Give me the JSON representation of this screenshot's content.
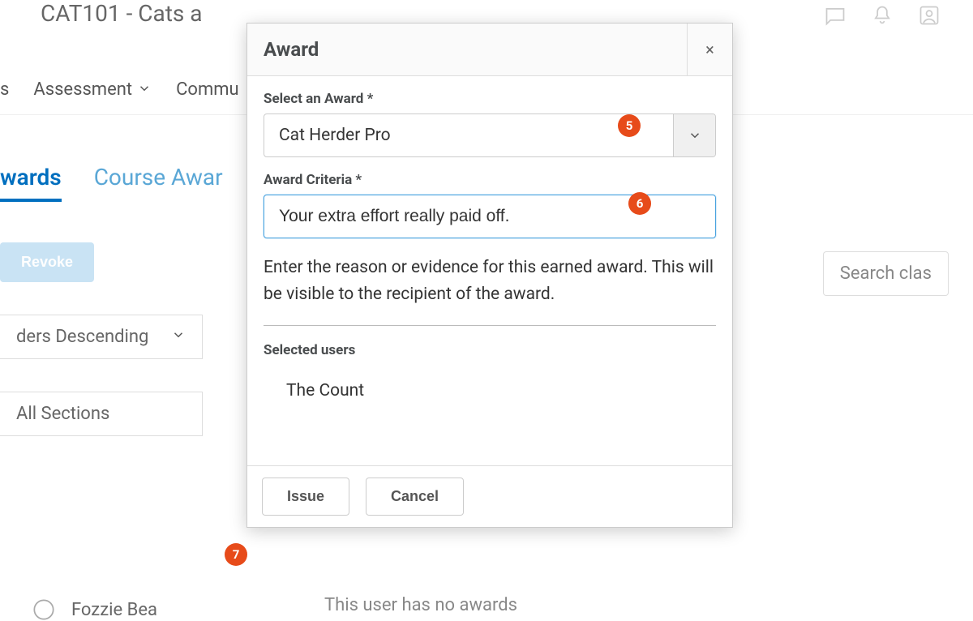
{
  "background": {
    "course_title": "CAT101 - Cats a",
    "nav": {
      "assessment": "Assessment",
      "communication": "Commu",
      "first_s": "s"
    },
    "tabs": {
      "classlist_awards": "wards",
      "course_awards": "Course Awar"
    },
    "revoke_btn": "Revoke",
    "sort_select": "ders Descending",
    "section_select": "All Sections",
    "search_placeholder": "Search clas",
    "user_name": "Fozzie Bea",
    "no_awards_text": "This user has no awards"
  },
  "modal": {
    "title": "Award",
    "close_symbol": "×",
    "select_label": "Select an Award *",
    "select_value": "Cat Herder Pro",
    "criteria_label": "Award Criteria *",
    "criteria_value": "Your extra effort really paid off.",
    "help_text": "Enter the reason or evidence for this earned award. This will be visible to the recipient of the award.",
    "selected_users_label": "Selected users",
    "selected_users": [
      "The Count"
    ],
    "issue_btn": "Issue",
    "cancel_btn": "Cancel"
  },
  "callouts": {
    "c5": "5",
    "c6": "6",
    "c7": "7"
  }
}
